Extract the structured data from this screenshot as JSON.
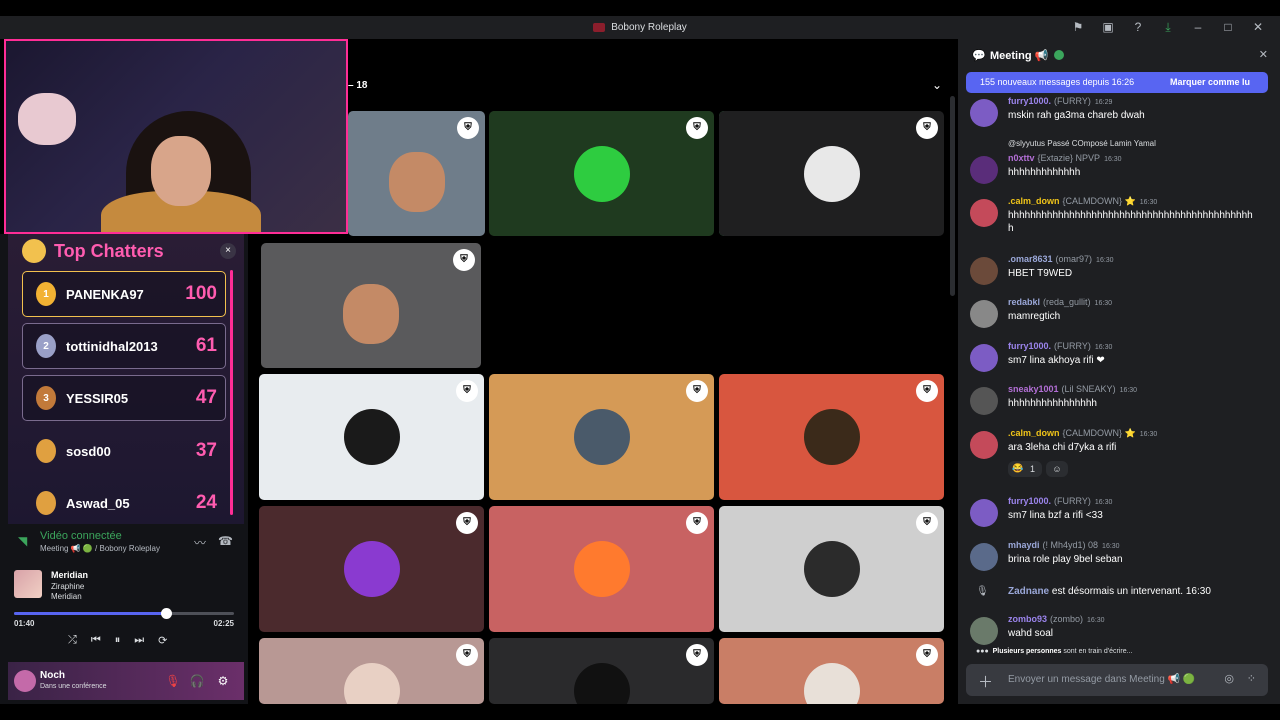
{
  "window": {
    "title": "Bobony Roleplay"
  },
  "top_chatters": {
    "title": "Top Chatters",
    "close": "×",
    "rows": [
      {
        "rank": "1",
        "name": "PANENKA97",
        "score": "100"
      },
      {
        "rank": "2",
        "name": "tottinidhal2013",
        "score": "61"
      },
      {
        "rank": "3",
        "name": "YESSIR05",
        "score": "47"
      },
      {
        "rank": "",
        "name": "sosd00",
        "score": "37"
      },
      {
        "rank": "",
        "name": "Aswad_05",
        "score": "24"
      }
    ]
  },
  "voice": {
    "status": "Vidéo connectée",
    "channel": "Meeting 📢 🟢 / Bobony Roleplay"
  },
  "music": {
    "track": "Meridian",
    "artist": "Ziraphine",
    "album": "Meridian",
    "elapsed": "01:40",
    "duration": "02:25",
    "progress": 0.69
  },
  "user": {
    "name": "Noch",
    "status": "Dans une conférence"
  },
  "stage": {
    "count": "18"
  },
  "tiles": [
    {
      "kind": "video",
      "bg": "#6f7d8a",
      "pin": "⛨"
    },
    {
      "kind": "video",
      "bg": "#a3202c",
      "pin": "⛨"
    },
    {
      "kind": "video",
      "bg": "#2c3a30",
      "pin": "⛨",
      "speaking": true
    },
    {
      "kind": "video",
      "bg": "#5a5a5c",
      "pin": "⛨"
    },
    {
      "kind": "avatar",
      "bg": "#1f3a1f",
      "avatar": "#2ecc40",
      "pin": "⛨"
    },
    {
      "kind": "avatar",
      "bg": "#1f1f20",
      "avatar": "#e8e8e8",
      "pin": "⛨"
    },
    {
      "kind": "avatar",
      "bg": "#e8ecef",
      "avatar": "#1a1a1a",
      "pin": "⛨"
    },
    {
      "kind": "avatar",
      "bg": "#d59a56",
      "avatar": "#4a5a6a",
      "pin": "⛨"
    },
    {
      "kind": "avatar",
      "bg": "#d8563f",
      "avatar": "#3b2a1a",
      "pin": "⛨"
    },
    {
      "kind": "avatar",
      "bg": "#4b2a2d",
      "avatar": "#8a3ad0",
      "pin": "⛨"
    },
    {
      "kind": "avatar",
      "bg": "#c86262",
      "avatar": "#ff7a2e",
      "pin": "⛨"
    },
    {
      "kind": "avatar",
      "bg": "#cfcfcf",
      "avatar": "#2b2b2b",
      "pin": "⛨"
    },
    {
      "kind": "avatar",
      "bg": "#b89894",
      "avatar": "#e8d0c4",
      "pin": "⛨"
    },
    {
      "kind": "avatar",
      "bg": "#2a2a2c",
      "avatar": "#111111",
      "pin": "⛨"
    },
    {
      "kind": "avatar",
      "bg": "#c97e66",
      "avatar": "#e8e0d8",
      "pin": "⛨"
    }
  ],
  "chat": {
    "channel": "Meeting 📢",
    "new_messages": "155 nouveaux messages depuis 16:26",
    "mark_read": "Marquer comme lu",
    "reply_context": "@slyyutus Passé COmposé Lamin Yamal",
    "messages": [
      {
        "author": "furry1000.",
        "tag": "(FURRY)",
        "time": "16:29",
        "text": "mskin rah ga3ma chareb dwah",
        "color": "#9b84ec",
        "avatar": "#7c5cc4"
      },
      {
        "author": "n0xttv",
        "tag": "{Extazie} NPVP",
        "time": "16:30",
        "text": "hhhhhhhhhhhhh",
        "color": "#b36fd6",
        "avatar": "#5a2d7a"
      },
      {
        "author": ".calm_down",
        "tag": "{CALMDOWN} ⭐",
        "time": "16:30",
        "text": "hhhhhhhhhhhhhhhhhhhhhhhhhhhhhhhhhhhhhhhhhhhhh",
        "color": "#f0c419",
        "avatar": "#c44a5a"
      },
      {
        "author": ".omar8631",
        "tag": "(omar97)",
        "time": "16:30",
        "text": "HBET T9WED",
        "color": "#9aa7d8",
        "avatar": "#6b4a3a"
      },
      {
        "author": "redabkl",
        "tag": "(reda_gullit)",
        "time": "16:30",
        "text": "mamregtich",
        "color": "#9aa7d8",
        "avatar": "#888"
      },
      {
        "author": "furry1000.",
        "tag": "(FURRY)",
        "time": "16:30",
        "text": "sm7 lina akhoya rifi ❤",
        "color": "#9b84ec",
        "avatar": "#7c5cc4"
      },
      {
        "author": "sneaky1001",
        "tag": "(Lil SNEAKY)",
        "time": "16:30",
        "text": "hhhhhhhhhhhhhhhh",
        "color": "#b36fd6",
        "avatar": "#555"
      },
      {
        "author": ".calm_down",
        "tag": "{CALMDOWN} ⭐",
        "time": "16:30",
        "text": "ara 3leha chi d7yka a rifi",
        "color": "#f0c419",
        "avatar": "#c44a5a"
      },
      {
        "author": "furry1000.",
        "tag": "(FURRY)",
        "time": "16:30",
        "text": "sm7 lina bzf a rifi <33",
        "color": "#9b84ec",
        "avatar": "#7c5cc4"
      },
      {
        "author": "mhaydi",
        "tag": "(! Mh4yd1) 08",
        "time": "16:30",
        "text": "brina role play 9bel seban",
        "color": "#9aa7d8",
        "avatar": "#5a6a8a"
      },
      {
        "author": "zombo93",
        "tag": "(zombo)",
        "time": "16:30",
        "text": "wahd soal",
        "color": "#9b84ec",
        "avatar": "#6a7a6a"
      }
    ],
    "system": {
      "author": "Zadnane",
      "text": "est désormais un intervenant.",
      "time": "16:30"
    },
    "reaction": {
      "emoji": "😂",
      "count": "1"
    },
    "typing": {
      "who": "Plusieurs personnes",
      "rest": "sont en train d'écrire..."
    },
    "input_placeholder": "Envoyer un message dans Meeting 📢 🟢"
  }
}
